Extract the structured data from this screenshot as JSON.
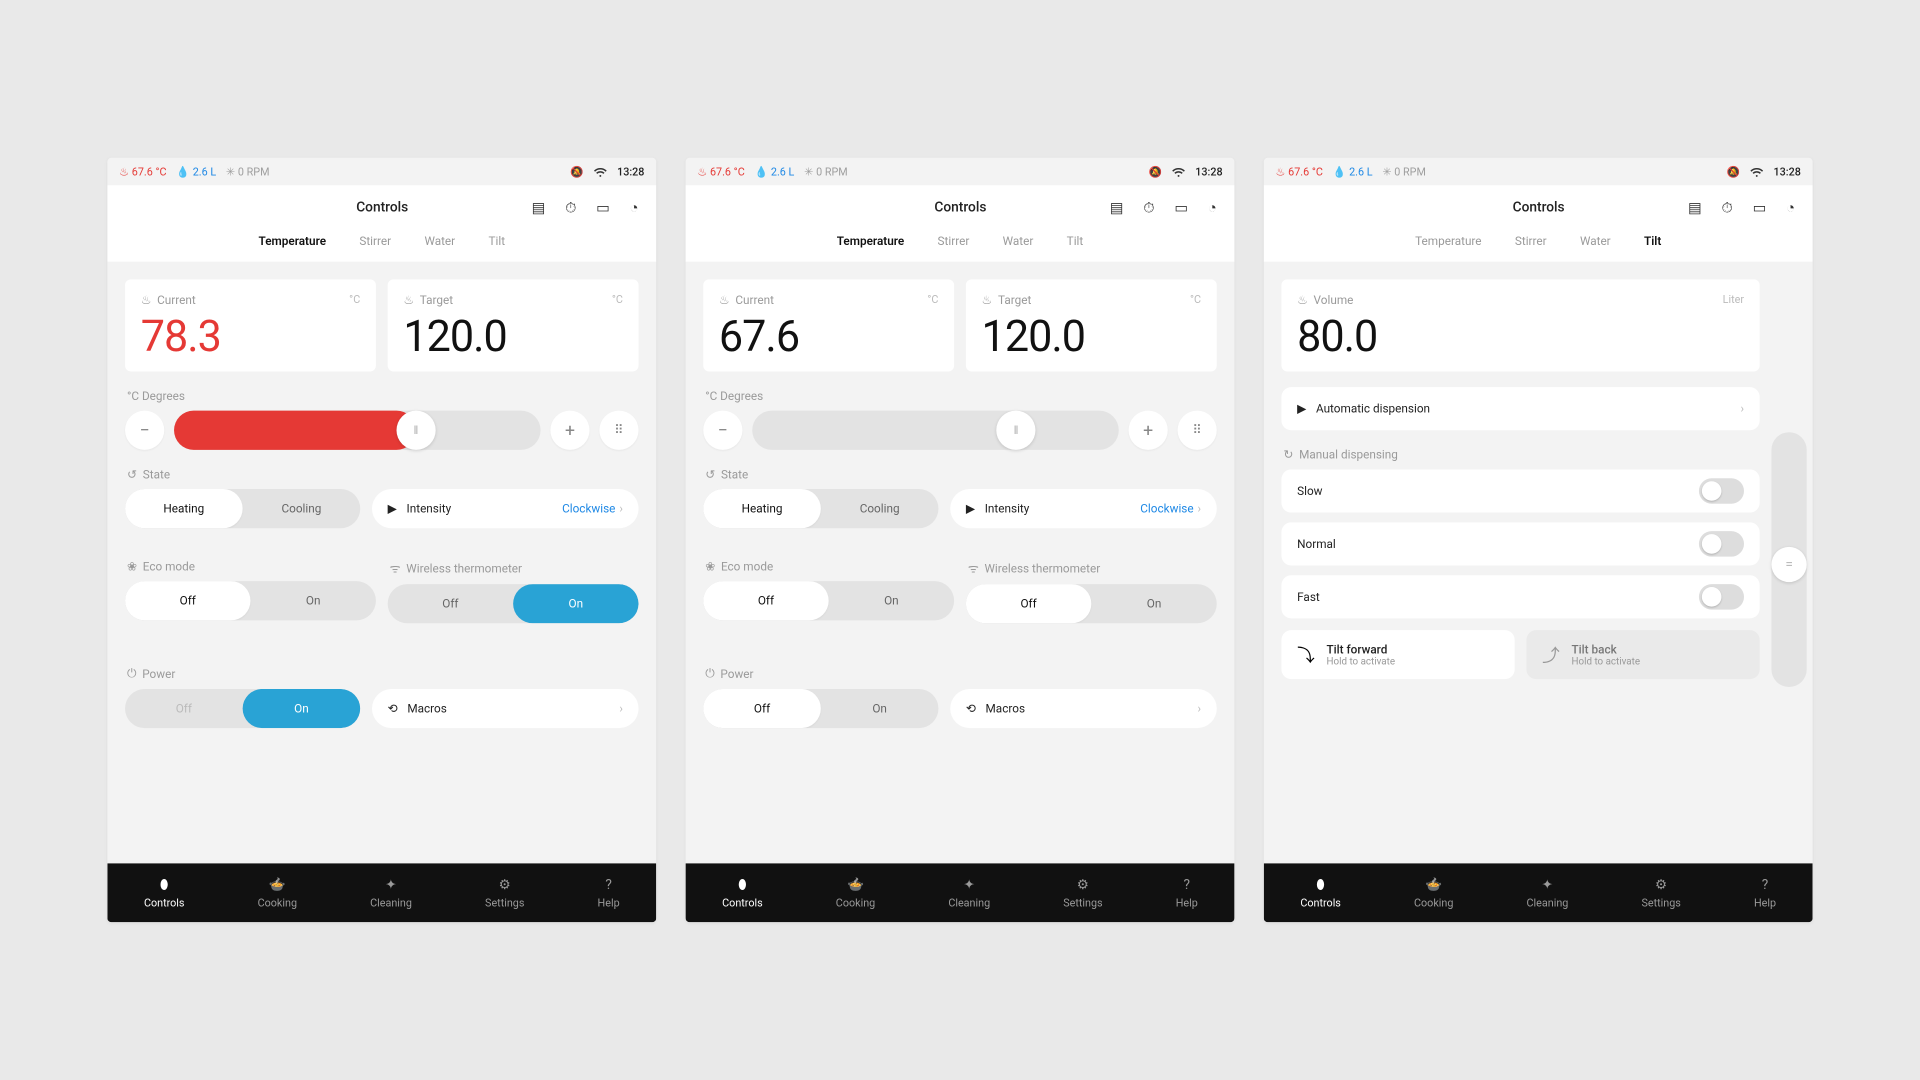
{
  "status": {
    "temp": "67.6 °C",
    "volume": "2.6 L",
    "rpm": "0 RPM",
    "time": "13:28"
  },
  "header": {
    "title": "Controls",
    "tabs": [
      "Temperature",
      "Stirrer",
      "Water",
      "Tilt"
    ]
  },
  "screen1": {
    "active_tab": "Temperature",
    "current_label": "Current",
    "current_unit": "°C",
    "current_value": "78.3",
    "target_label": "Target",
    "target_unit": "°C",
    "target_value": "120.0",
    "degrees_label": "°C  Degrees",
    "slider_fill_pct": 66,
    "state_label": "State",
    "state_options": [
      "Heating",
      "Cooling"
    ],
    "state_active": "Heating",
    "intensity_label": "Intensity",
    "intensity_value": "Clockwise",
    "eco_label": "Eco mode",
    "eco_options": [
      "Off",
      "On"
    ],
    "eco_active": "Off",
    "wireless_label": "Wireless thermometer",
    "wireless_options": [
      "Off",
      "On"
    ],
    "wireless_active": "On",
    "wireless_active_blue": true,
    "power_label": "Power",
    "power_options": [
      "Off",
      "On"
    ],
    "power_active": "On",
    "power_active_blue": true,
    "power_off_dim": true,
    "macros_label": "Macros"
  },
  "screen2": {
    "active_tab": "Temperature",
    "current_label": "Current",
    "current_unit": "°C",
    "current_value": "67.6",
    "target_label": "Target",
    "target_unit": "°C",
    "target_value": "120.0",
    "degrees_label": "°C  Degrees",
    "slider_fill_pct": 0,
    "state_label": "State",
    "state_options": [
      "Heating",
      "Cooling"
    ],
    "state_active": "Heating",
    "intensity_label": "Intensity",
    "intensity_value": "Clockwise",
    "eco_label": "Eco mode",
    "eco_options": [
      "Off",
      "On"
    ],
    "eco_active": "Off",
    "wireless_label": "Wireless thermometer",
    "wireless_options": [
      "Off",
      "On"
    ],
    "wireless_active": "Off",
    "power_label": "Power",
    "power_options": [
      "Off",
      "On"
    ],
    "power_active": "Off",
    "macros_label": "Macros"
  },
  "screen3": {
    "active_tab": "Tilt",
    "volume_label": "Volume",
    "volume_unit": "Liter",
    "volume_value": "80.0",
    "auto_label": "Automatic dispension",
    "manual_label": "Manual dispensing",
    "speeds": [
      {
        "label": "Slow",
        "on": false
      },
      {
        "label": "Normal",
        "on": false
      },
      {
        "label": "Fast",
        "on": false
      }
    ],
    "tilt_forward": {
      "title": "Tilt forward",
      "sub": "Hold to activate"
    },
    "tilt_back": {
      "title": "Tilt back",
      "sub": "Hold to activate"
    }
  },
  "nav": {
    "items": [
      "Controls",
      "Cooking",
      "Cleaning",
      "Settings",
      "Help"
    ],
    "active": "Controls"
  }
}
